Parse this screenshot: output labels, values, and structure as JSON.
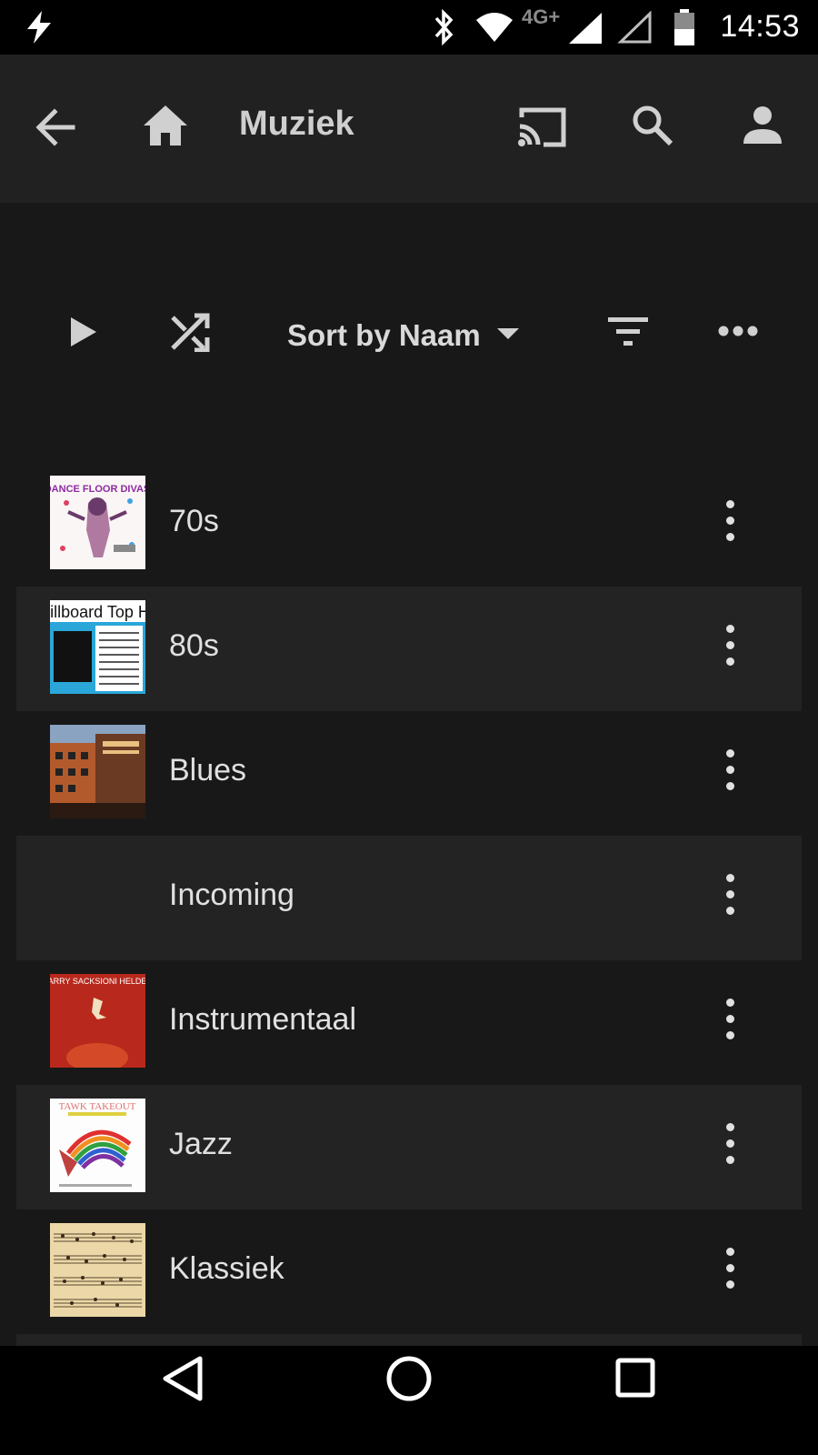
{
  "status_bar": {
    "time": "14:53",
    "network": "4G+",
    "icons": [
      "flash-icon",
      "bluetooth-icon",
      "wifi-icon",
      "signal-icon",
      "signal-empty-icon",
      "battery-icon"
    ]
  },
  "toolbar": {
    "title": "Muziek",
    "icons": [
      "back-arrow-icon",
      "home-icon",
      "cast-icon",
      "search-icon",
      "account-icon"
    ]
  },
  "controls": {
    "sort_label": "Sort by Naam",
    "icons": [
      "play-icon",
      "shuffle-icon",
      "dropdown-caret-icon",
      "filter-icon",
      "more-horizontal-icon"
    ]
  },
  "list": {
    "items": [
      {
        "label": "70s",
        "cover": "DANCE FLOOR DIVAS"
      },
      {
        "label": "80s",
        "cover": "Billboard Top Hits"
      },
      {
        "label": "Blues",
        "cover": ""
      },
      {
        "label": "Incoming",
        "cover": ""
      },
      {
        "label": "Instrumentaal",
        "cover": "HARRY SACKSIONI HELDEN"
      },
      {
        "label": "Jazz",
        "cover": "TAWK TAKEOUT"
      },
      {
        "label": "Klassiek",
        "cover": ""
      }
    ]
  },
  "colors": {
    "background": "#181818",
    "toolbar": "#212121",
    "row_alt": "#232323",
    "text": "#e0e0e0"
  }
}
